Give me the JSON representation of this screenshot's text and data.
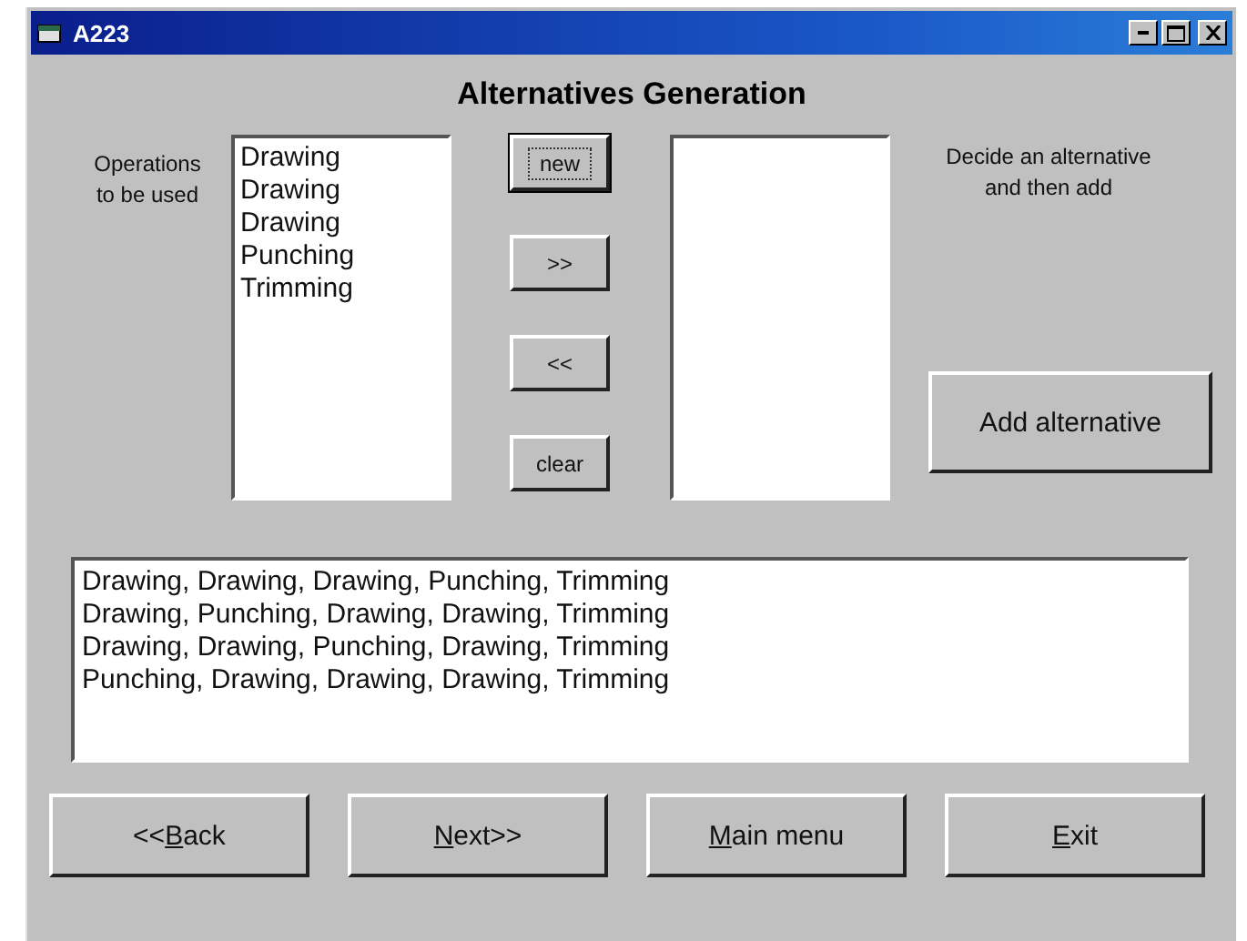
{
  "window": {
    "title": "A223"
  },
  "heading": "Alternatives Generation",
  "operations_label": "Operations to be used",
  "operations": [
    "Drawing",
    "Drawing",
    "Drawing",
    "Punching",
    "Trimming"
  ],
  "middle_buttons": [
    {
      "label": "new",
      "focused": true
    },
    {
      "label": ">>",
      "focused": false
    },
    {
      "label": "<<",
      "focused": false
    },
    {
      "label": "clear",
      "focused": false
    }
  ],
  "hint": "Decide an alternative and then add",
  "add_button": "Add alternative",
  "alternatives": [
    "Drawing, Drawing, Drawing, Punching, Trimming",
    "Drawing, Punching, Drawing, Drawing, Trimming",
    "Drawing, Drawing, Punching, Drawing, Trimming",
    "Punching, Drawing, Drawing, Drawing, Trimming"
  ],
  "nav_buttons": [
    {
      "before": "<<",
      "key": "B",
      "after": "ack"
    },
    {
      "key": "N",
      "after": "ext>>"
    },
    {
      "key": "M",
      "after": "ain menu"
    },
    {
      "key": "E",
      "after": "xit"
    }
  ]
}
